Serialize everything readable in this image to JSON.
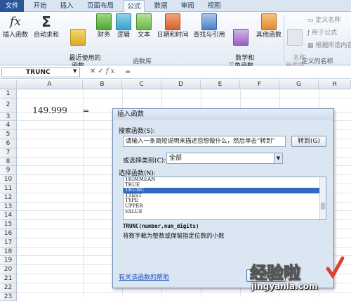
{
  "tabs": [
    "文件",
    "开始",
    "插入",
    "页面布局",
    "公式",
    "数据",
    "审阅",
    "视图"
  ],
  "ribbon": {
    "insert_fn": "插入函数",
    "autosum": "自动求和",
    "recent": "最近使用的\n函数",
    "finance": "财务",
    "logic": "逻辑",
    "text": "文本",
    "datetime": "日期和时间",
    "lookup": "查找与引用",
    "math": "数学和\n三角函数",
    "other": "其他函数",
    "group_label": "函数库",
    "name_mgr": "名称\n管理器",
    "define_name": "定义名称",
    "use_in_formula": "用于公式",
    "create_from_sel": "根据所选内容",
    "defined_names_group": "定义的名称"
  },
  "formula_bar": {
    "name_box": "TRUNC",
    "fx": "fx",
    "value": "="
  },
  "columns": [
    "A",
    "B",
    "C",
    "D",
    "E",
    "F",
    "G",
    "H"
  ],
  "rows": [
    "1",
    "2",
    "3",
    "4",
    "5",
    "6",
    "7",
    "8",
    "9",
    "10",
    "11",
    "12",
    "13",
    "14",
    "15",
    "16",
    "17",
    "18",
    "19",
    "20",
    "21",
    "22",
    "23"
  ],
  "cells": {
    "a2": "149.999",
    "b2": "="
  },
  "dialog": {
    "title": "插入函数",
    "search_label": "搜索函数(S):",
    "search_value": "请输入一条简短说明来描述您想做什么，然后单击“转到”",
    "go_button": "转到(G)",
    "category_label": "或选择类别(C):",
    "category_value": "全部",
    "select_label": "选择函数(N):",
    "functions": [
      "TRIMMEAN",
      "TRUE",
      "TRUNC",
      "TTEST",
      "TYPE",
      "UPPER",
      "VALUE"
    ],
    "selected": "TRUNC",
    "signature": "TRUNC(number,num_digits)",
    "description": "将数字截为整数或保留指定位数的小数",
    "help_link": "有关该函数的帮助",
    "ok_button": "确"
  },
  "watermark": {
    "text": "经验啦",
    "url": "jingyanla.com"
  },
  "colors": {
    "file_tab": "#2b579a",
    "selected": "#3169c6",
    "link": "#1f4fbf"
  }
}
